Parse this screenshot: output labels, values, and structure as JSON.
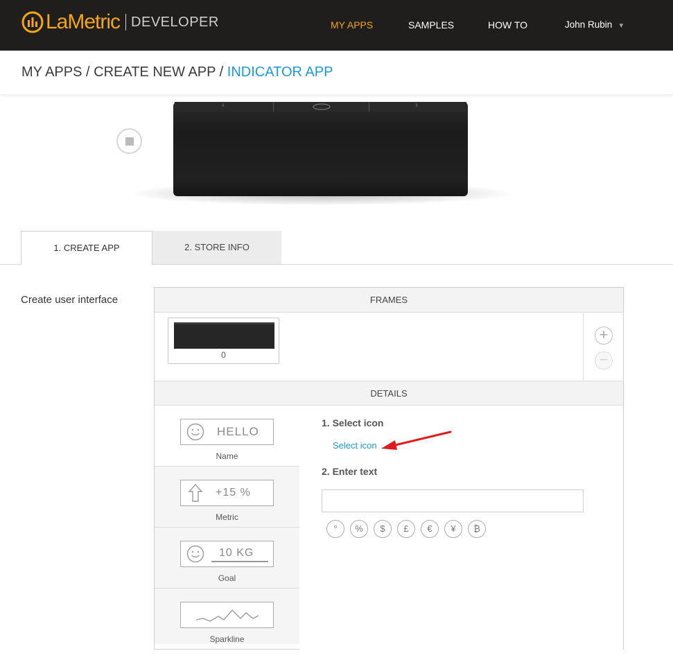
{
  "header": {
    "logo_text": "LaMetric",
    "logo_sub": "DEVELOPER",
    "nav": [
      "MY APPS",
      "SAMPLES",
      "HOW TO"
    ],
    "user_name": "John Rubin"
  },
  "breadcrumb": {
    "items": [
      "MY APPS",
      "CREATE NEW APP"
    ],
    "separator": "/",
    "current": "INDICATOR APP"
  },
  "tabs": [
    "1. CREATE APP",
    "2. STORE INFO"
  ],
  "section_label": "Create user interface",
  "frames": {
    "title": "FRAMES",
    "items": [
      {
        "index": "0"
      }
    ]
  },
  "details": {
    "title": "DETAILS",
    "templates": [
      {
        "name": "Name",
        "preview": "HELLO"
      },
      {
        "name": "Metric",
        "preview": "+15 %"
      },
      {
        "name": "Goal",
        "preview": "10 KG"
      },
      {
        "name": "Sparkline",
        "preview": ""
      }
    ],
    "step1_label": "1. Select icon",
    "select_icon_link": "Select icon",
    "step2_label": "2. Enter text",
    "text_value": "",
    "symbols": [
      "°",
      "%",
      "$",
      "£",
      "€",
      "¥",
      "₿"
    ]
  },
  "colors": {
    "accent": "#f2a618",
    "link": "#1a9ad8",
    "arrow": "#e01b1b",
    "nav_bg": "#1f1e1d"
  }
}
